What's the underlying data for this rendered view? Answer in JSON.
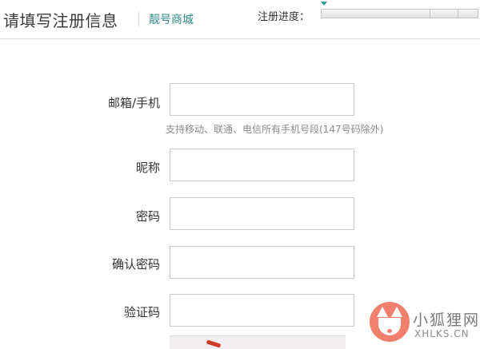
{
  "header": {
    "title": "请填写注册信息",
    "site_name": "靓号商城",
    "progress_label": "注册进度："
  },
  "form": {
    "email_phone": {
      "label": "邮箱/手机",
      "value": "",
      "hint": "支持移动、联通、电信所有手机号段(147号码除外)"
    },
    "nickname": {
      "label": "昵称",
      "value": ""
    },
    "password": {
      "label": "密码",
      "value": ""
    },
    "confirm_password": {
      "label": "确认密码",
      "value": ""
    },
    "captcha": {
      "label": "验证码",
      "value": ""
    }
  },
  "watermark": {
    "title": "小狐狸网",
    "domain": "XHLKS.CN"
  },
  "colors": {
    "site_name": "#2e8b8b",
    "hint_text": "#8a8a8a",
    "input_border": "#c9c9c9",
    "watermark_logo": "#f07f6b"
  }
}
